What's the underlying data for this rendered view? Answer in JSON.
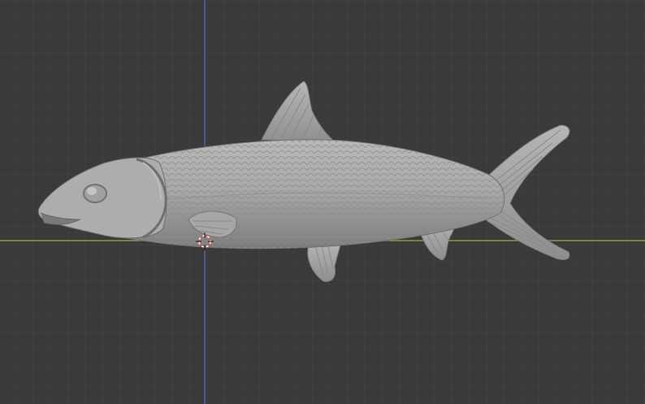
{
  "viewport": {
    "background_color": "#3a3a3a",
    "grid_minor_color": "#444444",
    "grid_major_color": "#4a4a4a",
    "x_axis_color": "#8cb33a",
    "y_axis_color": "#4a70c8",
    "model_name": "fish sculpt",
    "model_color": "#a5a5a5",
    "model_shadow_color": "#707070",
    "model_highlight_color": "#c8c8c8",
    "cursor_color_a": "#ff3b3b",
    "cursor_color_b": "#ffffff",
    "cursor_icon": "crosshair-3d-cursor-icon"
  }
}
